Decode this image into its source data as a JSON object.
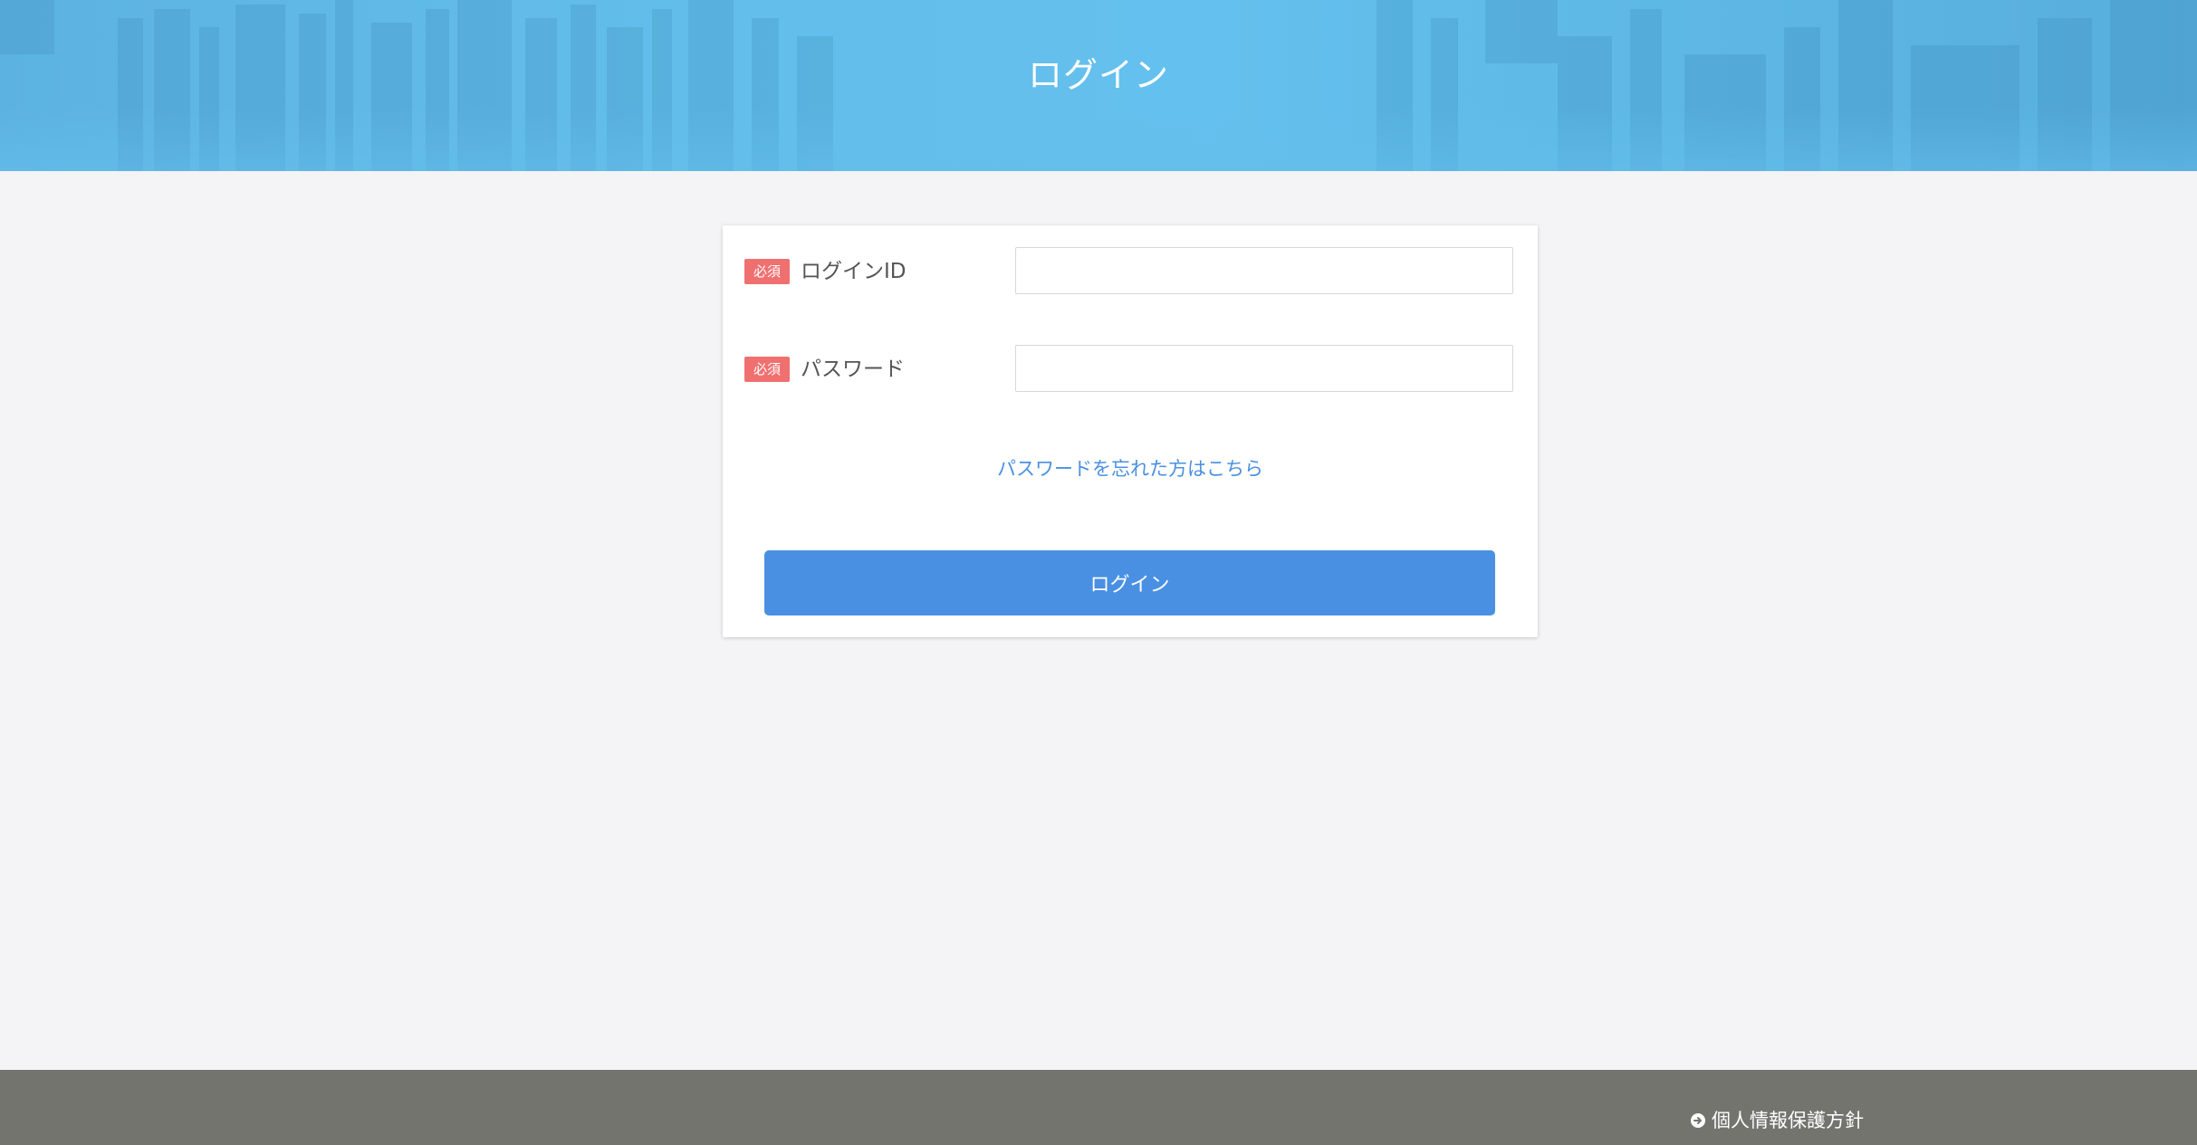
{
  "header": {
    "title": "ログイン"
  },
  "form": {
    "login_id": {
      "required_badge": "必須",
      "label": "ログインID",
      "value": ""
    },
    "password": {
      "required_badge": "必須",
      "label": "パスワード",
      "value": ""
    },
    "forgot_link": "パスワードを忘れた方はこちら",
    "submit_label": "ログイン"
  },
  "footer": {
    "privacy_link": "個人情報保護方針",
    "privacy_icon": "circle-arrow-right-icon"
  },
  "colors": {
    "header_blue": "#64c0ee",
    "required_badge": "#f07070",
    "link_blue": "#4a90e2",
    "button_blue": "#4a90e2",
    "page_background": "#f4f3f6",
    "footer_gray": "#74746f"
  }
}
